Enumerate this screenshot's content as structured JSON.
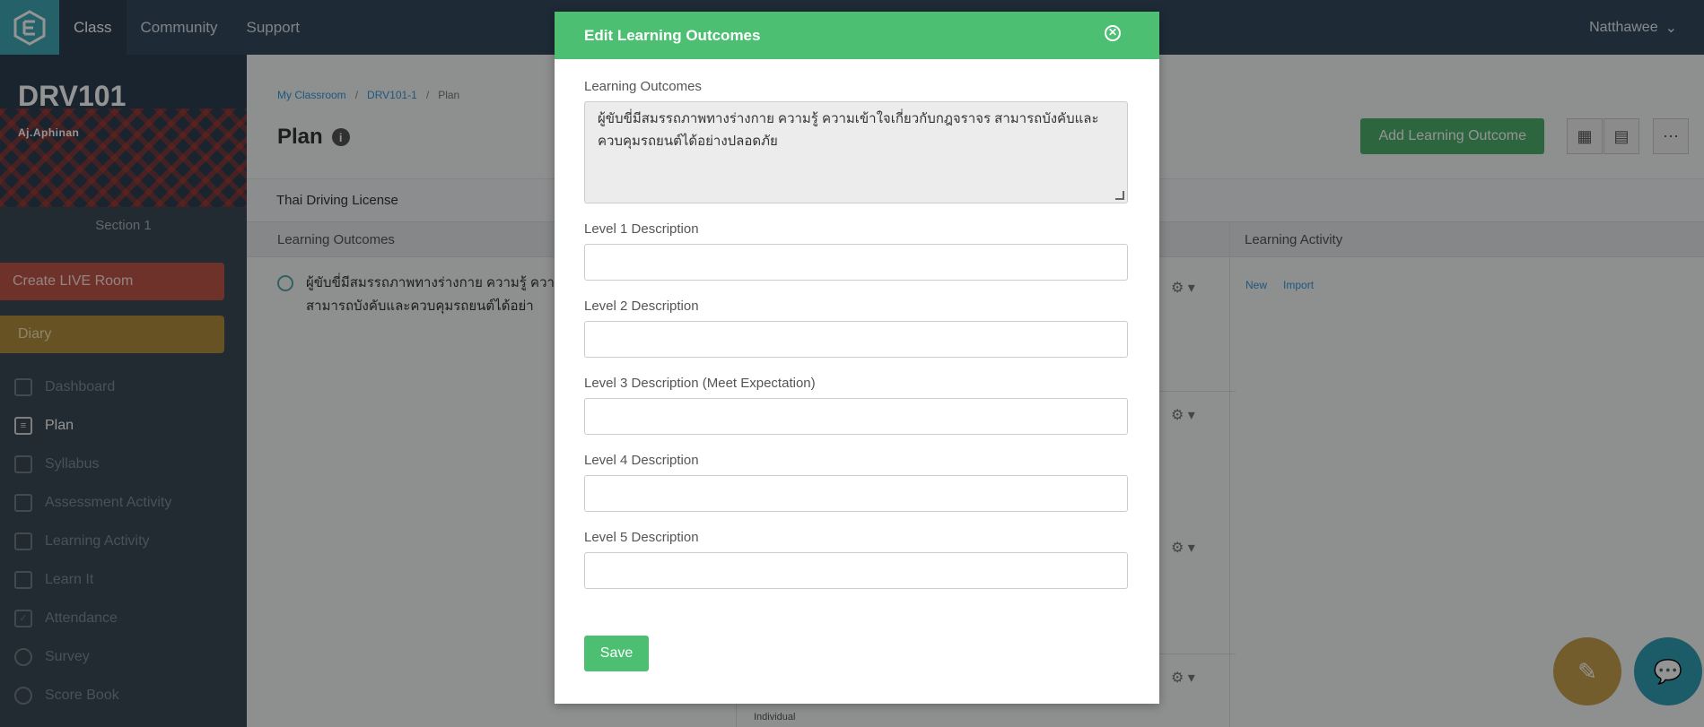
{
  "nav": {
    "items": [
      {
        "label": "Class",
        "active": true
      },
      {
        "label": "Community",
        "active": false
      },
      {
        "label": "Support",
        "active": false
      }
    ],
    "user": "Natthawee"
  },
  "sidebar": {
    "course_code": "DRV101",
    "teacher": "Aj.Aphinan",
    "section": "Section 1",
    "live_button": "Create LIVE Room",
    "diary_button": "Diary",
    "menu": [
      {
        "label": "Dashboard",
        "icon": "dashboard-icon"
      },
      {
        "label": "Plan",
        "icon": "plan-icon",
        "active": true
      },
      {
        "label": "Syllabus",
        "icon": "syllabus-icon"
      },
      {
        "label": "Assessment Activity",
        "icon": "trophy-icon"
      },
      {
        "label": "Learning Activity",
        "icon": "folder-icon"
      },
      {
        "label": "Learn It",
        "icon": "learn-it-icon"
      },
      {
        "label": "Attendance",
        "icon": "attendance-icon"
      },
      {
        "label": "Survey",
        "icon": "survey-icon"
      },
      {
        "label": "Score Book",
        "icon": "score-book-icon"
      }
    ]
  },
  "main": {
    "breadcrumbs": [
      "My Classroom",
      "DRV101-1",
      "Plan"
    ],
    "title": "Plan",
    "add_button": "Add Learning Outcome",
    "subject": "Thai Driving License",
    "columns": {
      "learning_outcomes": "Learning Outcomes",
      "learning_activity": "Learning Activity"
    },
    "row_text": "ผู้ขับขี่มีสมรรถภาพทางร่างกาย ความรู้ ความ จราจร สามารถบังคับและควบคุมรถยนต์ได้อย่า",
    "la_links": [
      "New",
      "Import"
    ],
    "individual": "Individual"
  },
  "modal": {
    "title": "Edit Learning Outcomes",
    "outcome_label": "Learning Outcomes",
    "outcome_value": "ผู้ขับขี่มีสมรรถภาพทางร่างกาย ความรู้ ความเข้าใจเกี่ยวกับกฎจราจร สามารถบังคับและควบคุมรถยนต์ได้อย่างปลอดภัย",
    "levels": [
      {
        "label": "Level 1 Description",
        "value": ""
      },
      {
        "label": "Level 2 Description",
        "value": ""
      },
      {
        "label": "Level 3 Description (Meet Expectation)",
        "value": ""
      },
      {
        "label": "Level 4 Description",
        "value": ""
      },
      {
        "label": "Level 5 Description",
        "value": ""
      }
    ],
    "save_label": "Save"
  },
  "colors": {
    "brand_green": "#4cbf73",
    "nav_bg": "#34495e",
    "live_red": "#c0574b",
    "diary_gold": "#b08d3c"
  }
}
